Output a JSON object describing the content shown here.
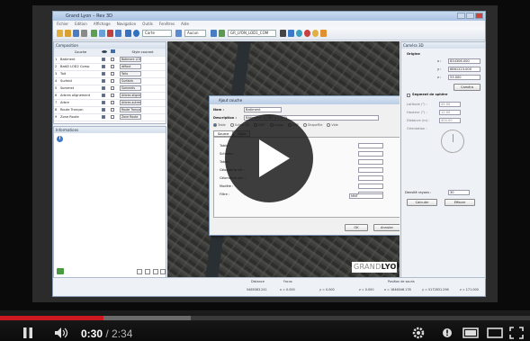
{
  "app": {
    "title": "Grand Lyon  –  Rev 3D",
    "menu": [
      "Fichier",
      "Edition",
      "Affichage",
      "Navigation",
      "Outils",
      "Fenêtres",
      "Aide"
    ],
    "toolbar": {
      "style_combo": "Carte",
      "render_combo": "Aucun",
      "layer_combo": "GR_LYON_LOD1_COM"
    }
  },
  "composition": {
    "title": "Composition",
    "columns": [
      "",
      "Couche",
      "",
      "",
      "Style courant"
    ],
    "rows": [
      {
        "num": "1",
        "layer": "Batiment",
        "style": "Batiment LOD0 extrudé"
      },
      {
        "num": "2",
        "layer": "BatiD LOD2 Comp",
        "style": "défaut"
      },
      {
        "num": "3",
        "layer": "Toit",
        "style": "Toits"
      },
      {
        "num": "4",
        "layer": "Surfaid",
        "style": "Surfaids"
      },
      {
        "num": "5",
        "layer": "Sommet",
        "style": "Sommets"
      },
      {
        "num": "6",
        "layer": "Arbres alignement",
        "style": "Arbres alignement"
      },
      {
        "num": "7",
        "layer": "Arbre",
        "style": "Arbres autres"
      },
      {
        "num": "8",
        "layer": "Route Tronçon",
        "style": "Route Tronçon"
      },
      {
        "num": "9",
        "layer": "Zone Route",
        "style": "Zone Route"
      }
    ]
  },
  "informations": {
    "title": "Informations"
  },
  "right_panel": {
    "title": "Caméra 3D",
    "origine_label": "Origine",
    "x_label": "x :",
    "x_value": "834306.000",
    "y_label": "y :",
    "y_value": "6861223.000",
    "z_label": "z :",
    "z_value": "53.000",
    "button": "Caméra",
    "segment_label": "Segment de sphère",
    "fields": [
      {
        "label": "Latitude (°) :",
        "value": "45.00"
      },
      {
        "label": "Hauteur (°) :",
        "value": "12.00"
      },
      {
        "label": "Distance (m) :",
        "value": "400.00"
      }
    ],
    "orientation_label": "Orientation :",
    "density_label": "Densité rayons :",
    "density_value": "30",
    "calc_button": "Calculer",
    "clear_button": "Effacer"
  },
  "dialog": {
    "title": "Ajout couche",
    "nom_label": "Nom :",
    "nom_value": "Batiment",
    "desc_label": "Description :",
    "desc_value": "Bâtiments (LOD0 à LOD2)",
    "radios": [
      "Table",
      "Scène 3D",
      "MNT",
      "Image",
      "DXF",
      "ShapeFile",
      "Vide"
    ],
    "tabs": [
      "Source",
      "Style"
    ],
    "fields": [
      "Table :",
      "Schéma :",
      "Table :",
      "Géométrie réf. :",
      "Géométrie ext. :",
      "Modèle :",
      "Filtre :"
    ],
    "combo_value": "MNT",
    "ok": "OK",
    "cancel": "Annuler"
  },
  "map": {
    "watermark_a": "GRAND",
    "watermark_b": "LYON"
  },
  "statusbar": {
    "distance_label": "Distance",
    "distance_value": "5465083.241",
    "focus_label": "Focus",
    "fx": "x = 0.000",
    "fy": "y = 0.000",
    "fz": "z = 0.000",
    "pos_label": "Position de souris",
    "px": "x = 1846046.178",
    "py": "y = 5172831.296",
    "pz": "z = 171.000"
  },
  "player": {
    "current_time": "0:30",
    "separator": " / ",
    "duration": "2:34",
    "progress_fraction": 0.195,
    "loaded_fraction": 0.36
  },
  "colors": {
    "accent": "#cc181e",
    "window": "#eef1f5",
    "map": "#3a3a38"
  }
}
